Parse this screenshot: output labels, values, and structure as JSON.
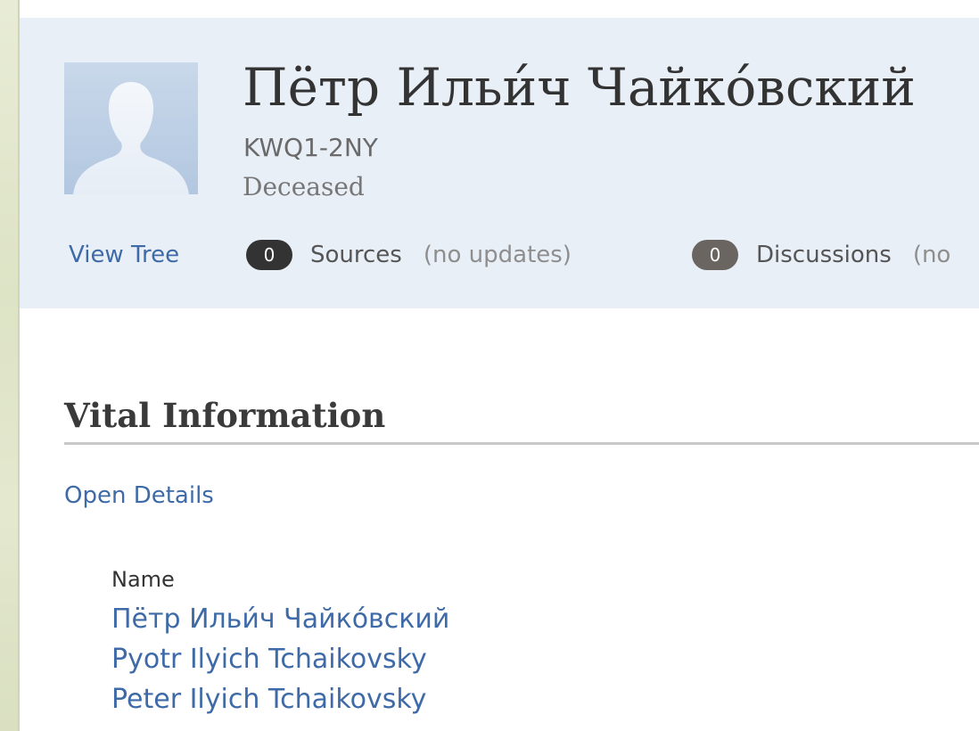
{
  "person": {
    "name": "Пётр Ильи́ч Чайко́вский",
    "id": "KWQ1-2NY",
    "status": "Deceased",
    "avatar_icon": "person-silhouette-icon"
  },
  "actions": {
    "view_tree": "View Tree"
  },
  "counts": {
    "sources": {
      "count": "0",
      "label": "Sources",
      "note": "(no updates)"
    },
    "discussions": {
      "count": "0",
      "label": "Discussions",
      "note": "(no"
    }
  },
  "vital_info": {
    "title": "Vital Information",
    "open_details": "Open Details",
    "name_label": "Name",
    "names": [
      "Пётр Ильи́ч Чайко́вский",
      "Pyotr Ilyich Tchaikovsky",
      "Peter Ilyich Tchaikovsky"
    ]
  },
  "colors": {
    "header_bg": "#e9eff7",
    "link": "#3e6aa8",
    "badge_sources": "#333333",
    "badge_discussions": "#6a6560"
  }
}
